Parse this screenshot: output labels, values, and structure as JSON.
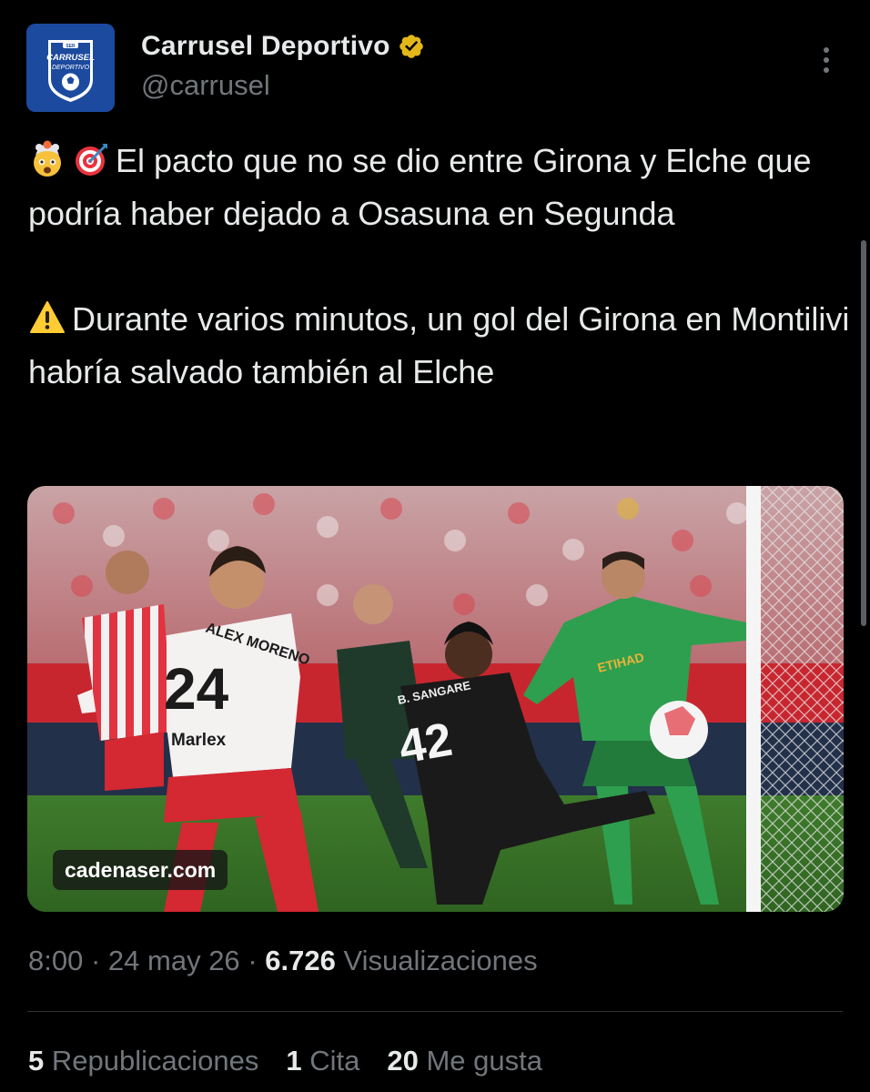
{
  "author": {
    "display_name": "Carrusel Deportivo",
    "handle": "@carrusel",
    "avatar_text_top": "CARRUSEL",
    "avatar_text_bottom": "DEPORTIVO",
    "avatar_badge": "SER",
    "verified_icon": "verified-gold-badge-icon"
  },
  "post": {
    "line1_emojis": [
      "exploding-head-emoji",
      "direct-hit-emoji"
    ],
    "paragraph1": "El pacto que no se dio entre Girona y Elche que podría haber dejado a Osasuna en Segunda",
    "line2_emoji": "warning-emoji",
    "paragraph2": "Durante varios minutos, un gol del Girona en Montilivi habría salvado también al Elche"
  },
  "media": {
    "watermark": "cadenaser.com",
    "jersey_name_1": "ALEX MORENO",
    "jersey_number_1": "24",
    "jersey_name_2": "B. SANGARE",
    "jersey_number_2": "42",
    "sponsor_1": "Marlex",
    "sponsor_2": "ETIHAD"
  },
  "meta": {
    "time": "8:00",
    "separator": "·",
    "date": "24 may 26",
    "views_count": "6.726",
    "views_label": "Visualizaciones"
  },
  "stats": {
    "reposts_count": "5",
    "reposts_label": "Republicaciones",
    "quotes_count": "1",
    "quotes_label": "Cita",
    "likes_count": "20",
    "likes_label": "Me gusta"
  },
  "colors": {
    "background": "#000000",
    "primary_text": "#e7e9ea",
    "secondary_text": "#71767b",
    "verified_gold": "#e2b719",
    "avatar_blue": "#1c4a9e"
  }
}
